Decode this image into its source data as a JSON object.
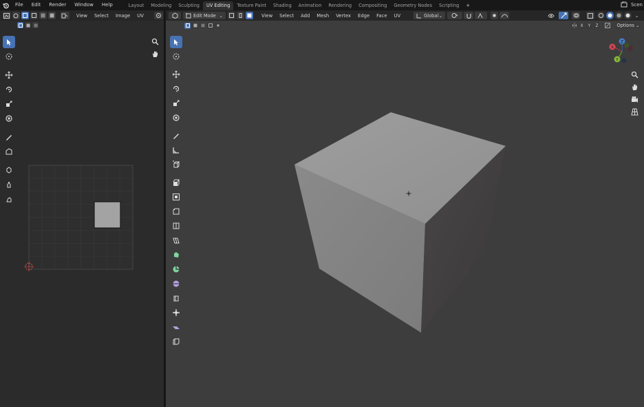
{
  "topbar": {
    "menus": [
      "File",
      "Edit",
      "Render",
      "Window",
      "Help"
    ],
    "workspaces": [
      "Layout",
      "Modeling",
      "Sculpting",
      "UV Editing",
      "Texture Paint",
      "Shading",
      "Animation",
      "Rendering",
      "Compositing",
      "Geometry Nodes",
      "Scripting"
    ],
    "active_workspace": "UV Editing",
    "add_tab": "+",
    "scene_label": "Scen"
  },
  "uv_editor": {
    "menus": [
      "View",
      "Select",
      "Image",
      "UV"
    ]
  },
  "viewport": {
    "mode": "Edit Mode",
    "menus": [
      "View",
      "Select",
      "Add",
      "Mesh",
      "Vertex",
      "Edge",
      "Face",
      "UV"
    ],
    "orientation": "Global",
    "options_label": "Options",
    "axes": [
      "X",
      "Y",
      "Z"
    ],
    "gizmo": {
      "x": "X",
      "y": "Y",
      "z": "Z"
    }
  },
  "colors": {
    "accent": "#4772b3",
    "cube_top": "#9a9a9a",
    "cube_left": "#8a8a8a",
    "cube_right": "#3f3d3d",
    "viewport_bg": "#3d3d3d"
  }
}
